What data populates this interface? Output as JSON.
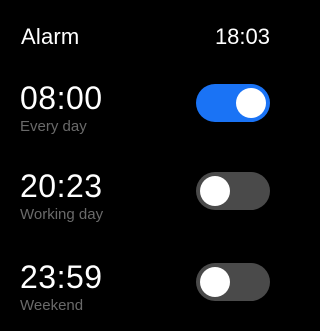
{
  "header": {
    "title": "Alarm",
    "time": "18:03"
  },
  "alarms": [
    {
      "time": "08:00",
      "repeat": "Every day",
      "enabled": true
    },
    {
      "time": "20:23",
      "repeat": "Working day",
      "enabled": false
    },
    {
      "time": "23:59",
      "repeat": "Weekend",
      "enabled": false
    }
  ],
  "colors": {
    "background": "#000000",
    "text": "#ffffff",
    "subtext": "#6a6a6a",
    "toggle_on": "#1a73f5",
    "toggle_off": "#4a4a4a",
    "knob": "#ffffff"
  }
}
